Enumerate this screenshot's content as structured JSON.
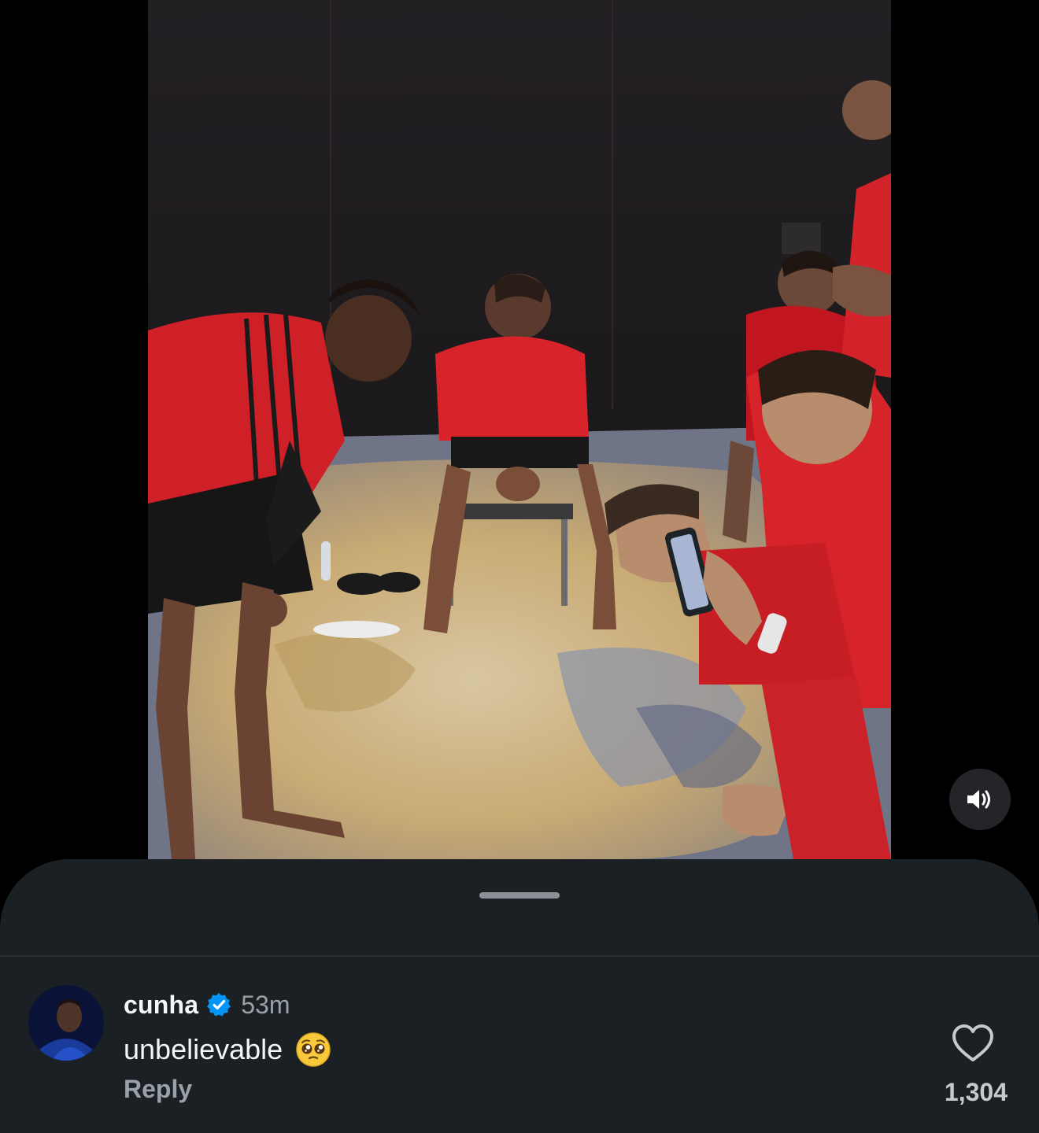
{
  "video": {
    "icons": {
      "mute": "speaker-icon"
    }
  },
  "sheet": {
    "comment": {
      "username": "cunha",
      "verified": true,
      "time": "53m",
      "text": "unbelievable",
      "emoji": "pleading-face-emoji",
      "reply_label": "Reply",
      "like_count": "1,304",
      "icons": {
        "like": "heart-outline-icon",
        "verified": "verified-badge-icon"
      }
    }
  },
  "colors": {
    "sheet_bg": "#1b2024",
    "primary_text": "#f3f5f7",
    "secondary_text": "#9aa1a7",
    "verified_blue": "#0095f6"
  }
}
